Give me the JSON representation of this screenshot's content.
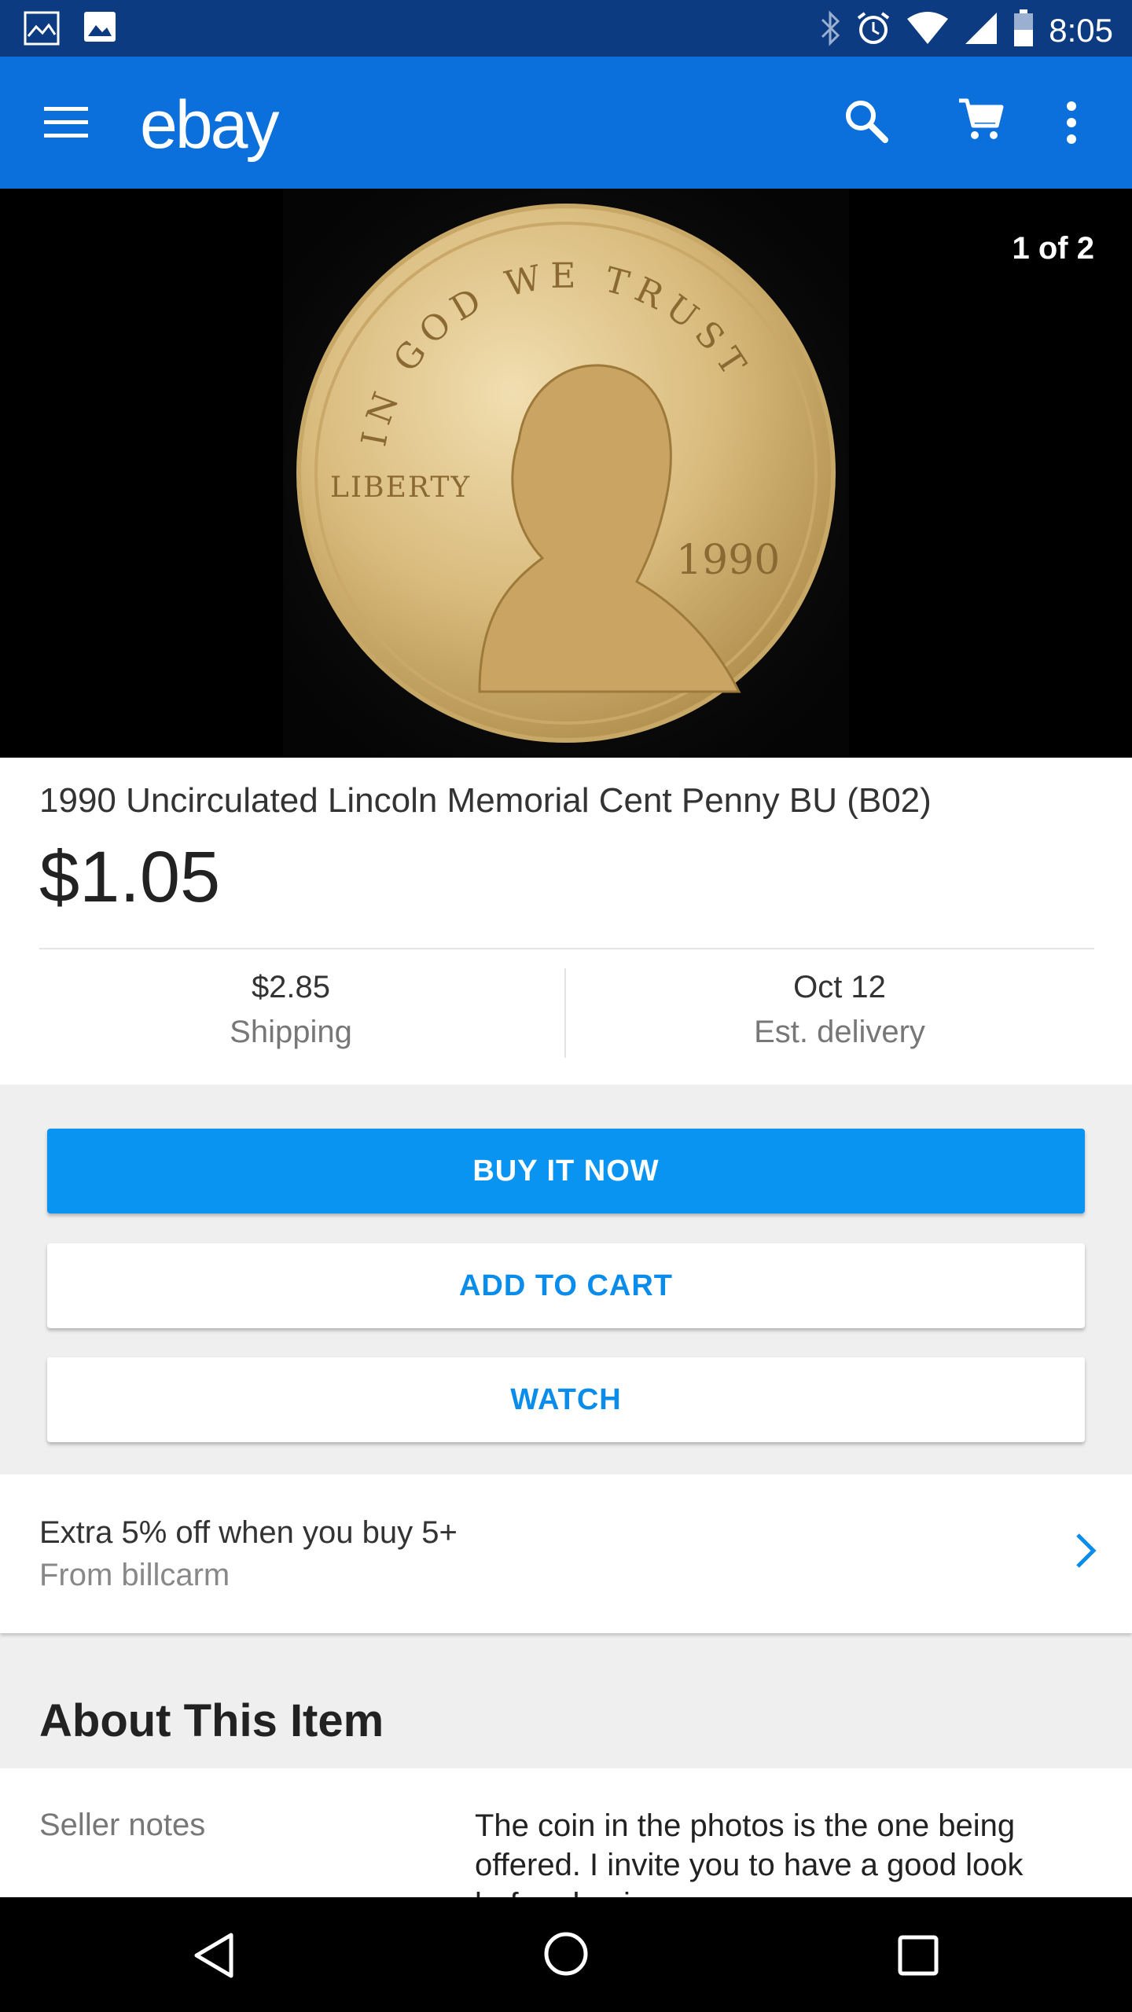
{
  "status_bar": {
    "time": "8:05",
    "icons": [
      "gallery-notification-icon",
      "image-notification-icon",
      "bluetooth-icon",
      "alarm-icon",
      "wifi-icon",
      "signal-icon",
      "battery-icon"
    ]
  },
  "app_bar": {
    "logo": "ebay",
    "icons": [
      "menu-icon",
      "search-icon",
      "cart-icon",
      "more-vert-icon"
    ],
    "color": "#0b6fdc"
  },
  "hero": {
    "page_indicator": "1 of 2",
    "coin_text": {
      "motto": "IN GOD WE TRUST",
      "liberty": "LIBERTY",
      "year": "1990"
    }
  },
  "item": {
    "title": "1990 Uncirculated Lincoln Memorial Cent Penny BU (B02)",
    "price": "$1.05",
    "shipping_value": "$2.85",
    "shipping_label": "Shipping",
    "delivery_value": "Oct 12",
    "delivery_label": "Est. delivery"
  },
  "actions": {
    "buy_now": "BUY IT NOW",
    "add_to_cart": "ADD TO CART",
    "watch": "WATCH",
    "primary_color": "#0a94f2"
  },
  "promo": {
    "title": "Extra 5% off when you buy 5+",
    "subtitle": "From billcarm",
    "icon": "chevron-right-icon"
  },
  "about": {
    "heading": "About This Item",
    "seller_notes_label": "Seller notes",
    "seller_notes_text": "The coin in the photos is the one being offered.  I invite you to have a good look before buying."
  },
  "nav_bar": {
    "icons": [
      "back-icon",
      "home-icon",
      "recents-icon"
    ]
  }
}
